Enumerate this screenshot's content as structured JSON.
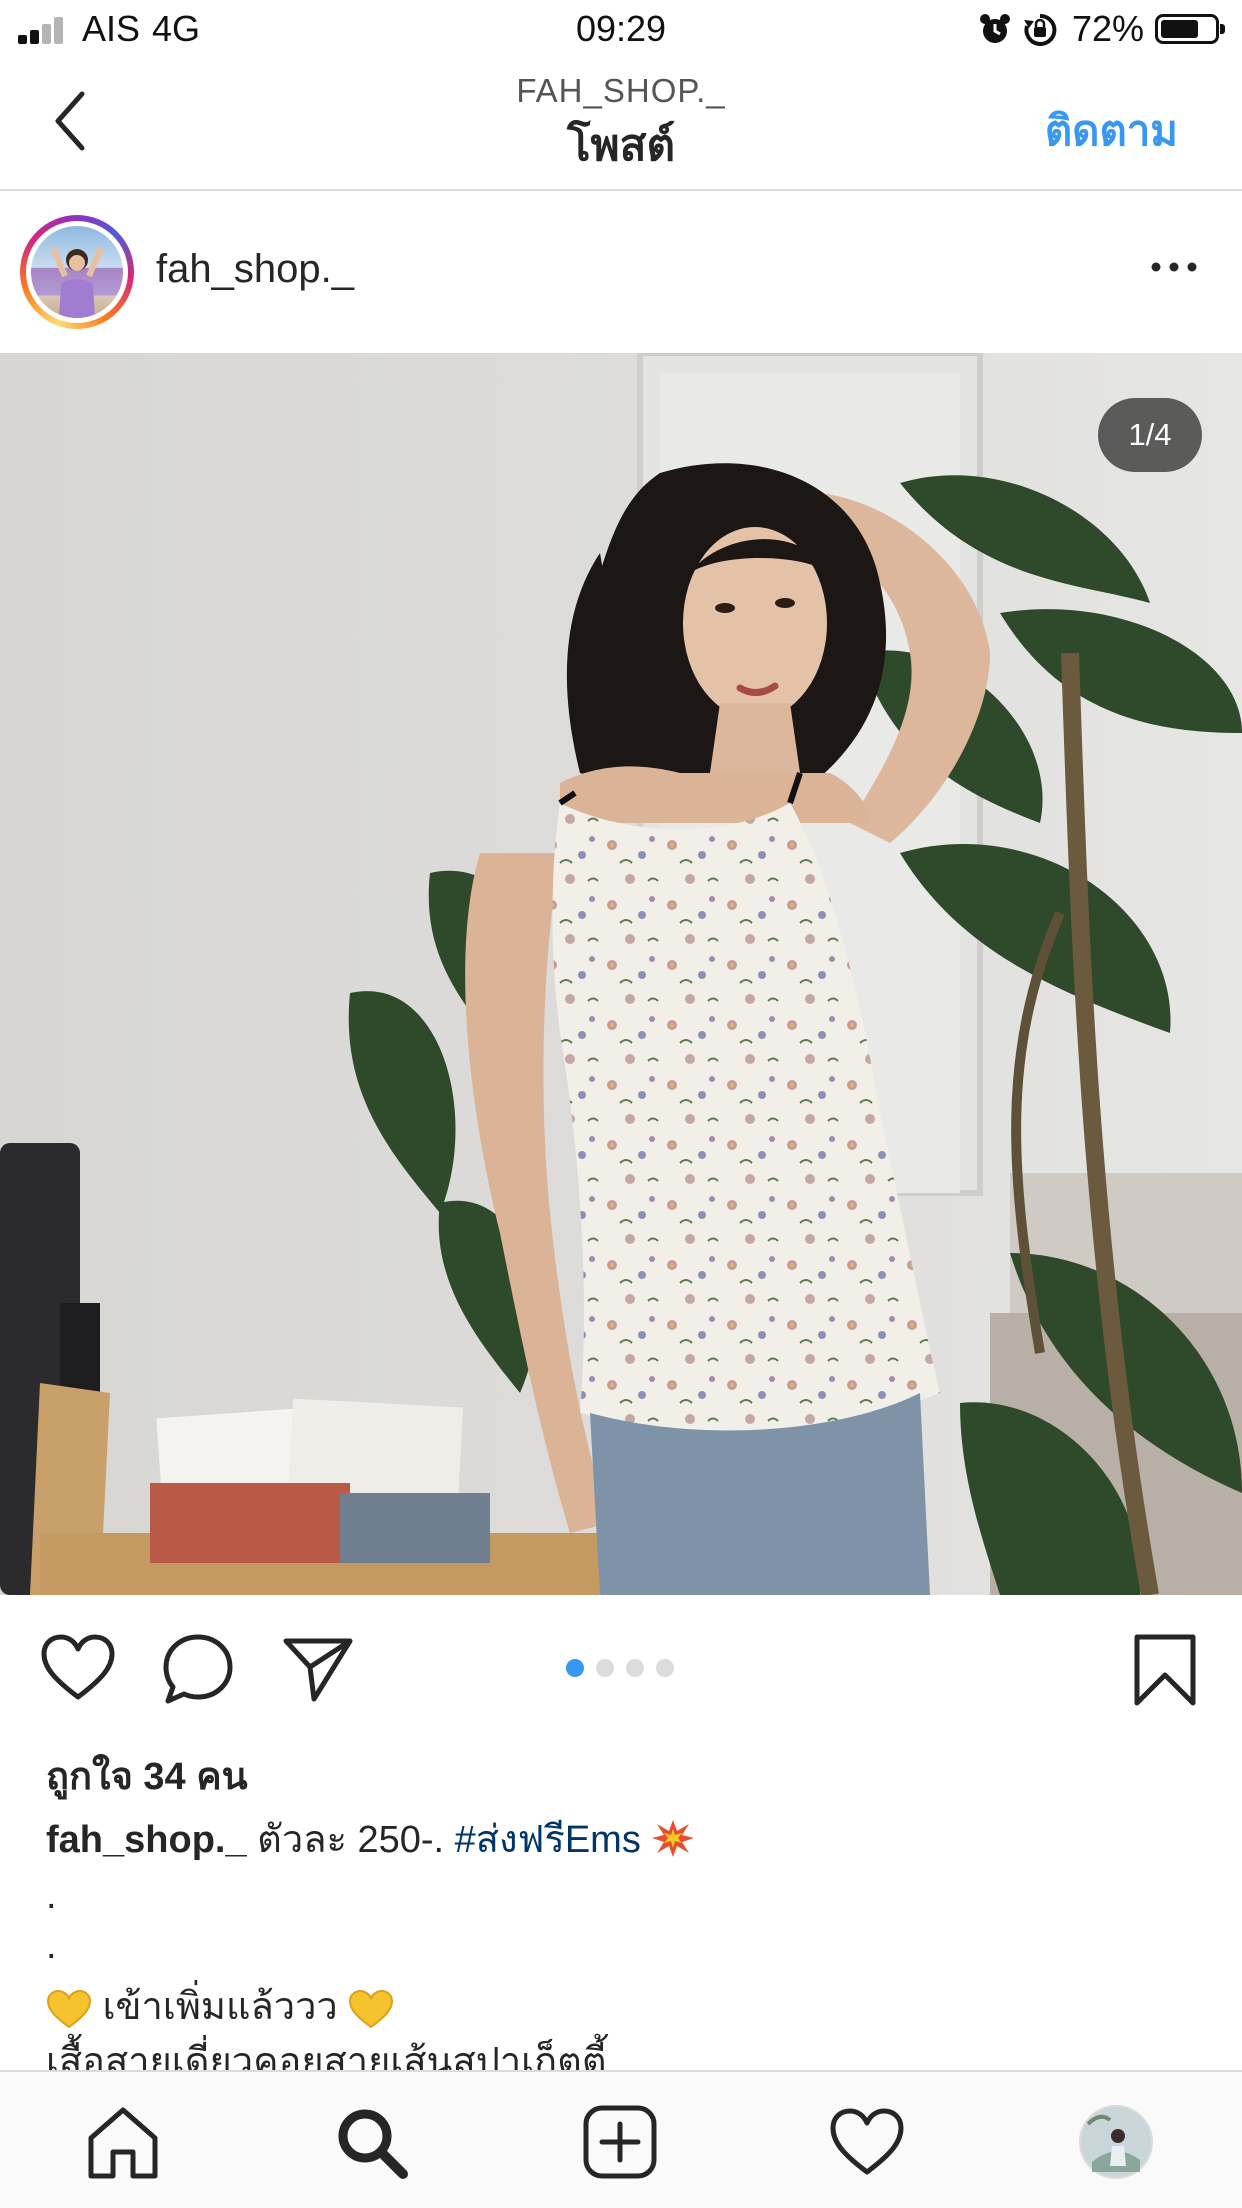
{
  "status_bar": {
    "carrier": "AIS",
    "network": "4G",
    "time": "09:29",
    "battery": "72%",
    "battery_level": 0.72
  },
  "header": {
    "subtitle": "FAH_SHOP._",
    "title": "โพสต์",
    "follow_label": "ติดตาม"
  },
  "post": {
    "username": "fah_shop._",
    "page_counter": "1/4",
    "carousel_total": 4,
    "carousel_active": 1,
    "likes": "ถูกใจ 34 คน",
    "caption": {
      "username": "fah_shop._",
      "text": "ตัวละ 250-.",
      "hashtag": "#ส่งฟรีEms",
      "line_dot_1": ".",
      "line_dot_2": ".",
      "new_arrival": "เข้าเพิ่มแล้ววว",
      "description": "เสื้อสายเดี่ยวคอยสายเส้นสปาเก็ตตี้"
    }
  },
  "colors": {
    "accent": "#3897f0",
    "hashtag": "#003569",
    "text": "#262626",
    "divider": "#dbdbdb"
  },
  "icons": {
    "back": "chevron-left-icon",
    "more": "more-horizontal-icon",
    "like": "heart-icon",
    "comment": "comment-bubble-icon",
    "share": "paper-plane-icon",
    "save": "bookmark-icon",
    "tabs": [
      "home-icon",
      "search-icon",
      "add-post-icon",
      "activity-heart-icon",
      "profile-avatar-icon"
    ]
  }
}
